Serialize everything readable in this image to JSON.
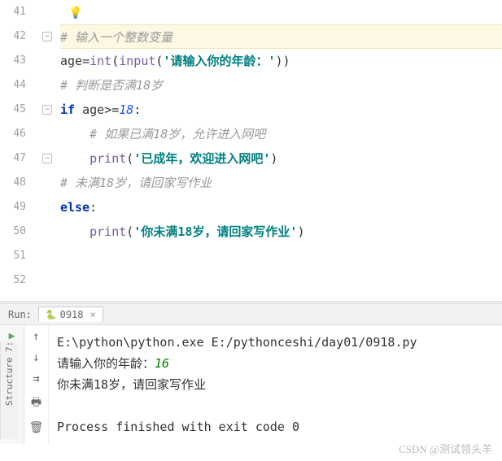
{
  "editor": {
    "lines": [
      {
        "num": "41",
        "bulb": true
      },
      {
        "num": "42",
        "tokens": [
          {
            "t": "# 输入一个整数变量",
            "c": "comment"
          }
        ],
        "hl": true,
        "fold": "open"
      },
      {
        "num": "43",
        "tokens": [
          {
            "t": "age",
            "c": "ident"
          },
          {
            "t": "=",
            "c": "op"
          },
          {
            "t": "int",
            "c": "builtin"
          },
          {
            "t": "(",
            "c": "op"
          },
          {
            "t": "input",
            "c": "builtin"
          },
          {
            "t": "(",
            "c": "op"
          },
          {
            "t": "'请输入你的年龄：'",
            "c": "string"
          },
          {
            "t": "))",
            "c": "op"
          }
        ]
      },
      {
        "num": "44",
        "tokens": [
          {
            "t": "# 判断是否满18岁",
            "c": "comment"
          }
        ]
      },
      {
        "num": "45",
        "tokens": [
          {
            "t": "if",
            "c": "keyword"
          },
          {
            "t": " age",
            "c": "ident"
          },
          {
            "t": ">=",
            "c": "op"
          },
          {
            "t": "18",
            "c": "number"
          },
          {
            "t": ":",
            "c": "op"
          }
        ],
        "fold": "open"
      },
      {
        "num": "46",
        "indent": 1,
        "tokens": [
          {
            "t": "# 如果已满18岁，允许进入网吧",
            "c": "comment"
          }
        ]
      },
      {
        "num": "47",
        "indent": 1,
        "tokens": [
          {
            "t": "print",
            "c": "builtin"
          },
          {
            "t": "(",
            "c": "op"
          },
          {
            "t": "'已成年，欢迎进入网吧'",
            "c": "string"
          },
          {
            "t": ")",
            "c": "op"
          }
        ],
        "fold": "close"
      },
      {
        "num": "48",
        "tokens": [
          {
            "t": "# 未满18岁，请回家写作业",
            "c": "comment"
          }
        ]
      },
      {
        "num": "49",
        "tokens": [
          {
            "t": "else",
            "c": "keyword"
          },
          {
            "t": ":",
            "c": "op"
          }
        ]
      },
      {
        "num": "50",
        "indent": 1,
        "tokens": [
          {
            "t": "print",
            "c": "builtin"
          },
          {
            "t": "(",
            "c": "op"
          },
          {
            "t": "'你未满18岁，请回家写作业'",
            "c": "string"
          },
          {
            "t": ")",
            "c": "op"
          }
        ]
      },
      {
        "num": "51"
      },
      {
        "num": "52"
      }
    ]
  },
  "run": {
    "label": "Run:",
    "tab_name": "0918",
    "console": {
      "cmd": "E:\\python\\python.exe E:/pythonceshi/day01/0918.py",
      "prompt": "请输入你的年龄：",
      "input": "16",
      "output": "你未满18岁，请回家写作业",
      "exit": "Process finished with exit code 0"
    }
  },
  "sidebar": {
    "structure": "Structure",
    "num": "7:"
  },
  "watermark": "CSDN @测试领头羊"
}
